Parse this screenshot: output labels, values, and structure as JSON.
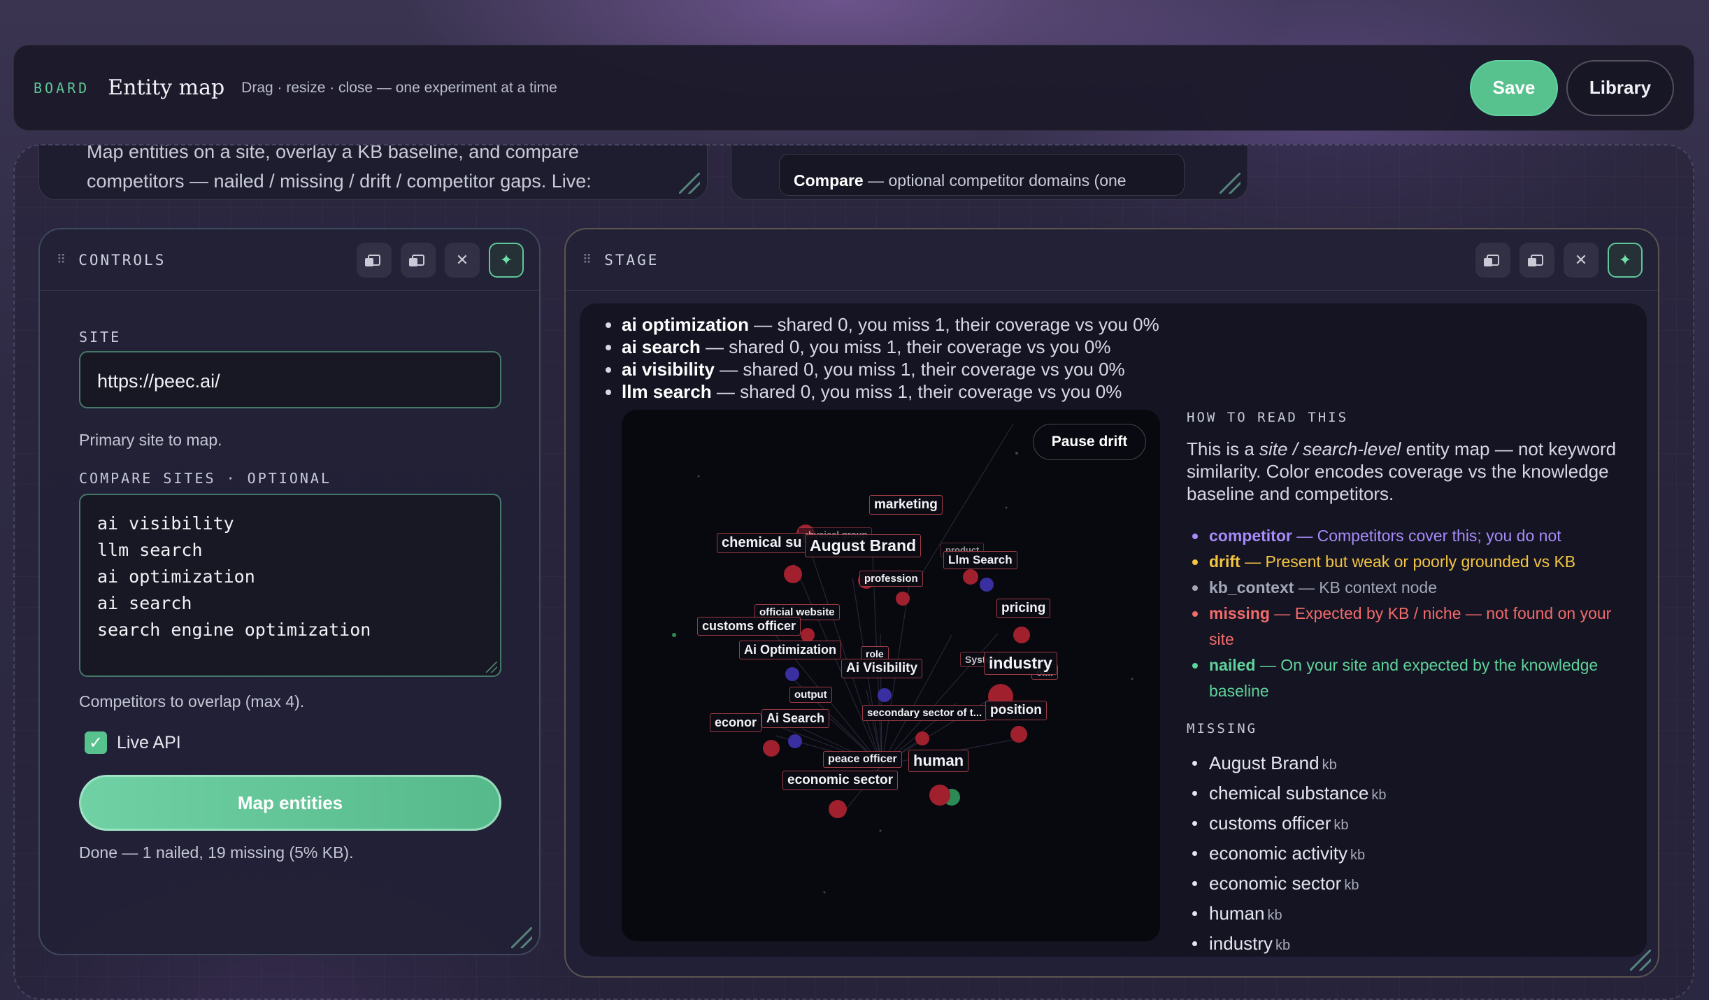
{
  "board": {
    "tag": "BOARD",
    "title": "Entity map",
    "subtitle": "Drag · resize · close — one experiment at a time",
    "save_label": "Save",
    "library_label": "Library"
  },
  "top_cards": {
    "intro_line1": "Map entities on a site, overlay a KB baseline, and compare",
    "intro_line2": "competitors — nailed / missing / drift / competitor gaps. Live:",
    "compare_bold": "Compare",
    "compare_rest": " — optional competitor domains (one"
  },
  "controls": {
    "title": "CONTROLS",
    "site_label": "SITE",
    "site_value": "https://peec.ai/",
    "site_help": "Primary site to map.",
    "compare_label": "COMPARE SITES · OPTIONAL",
    "compare_lines": [
      "ai visibility",
      "llm search",
      "ai optimization",
      "ai search",
      "search engine optimization"
    ],
    "compare_help": "Competitors to overlap (max 4).",
    "live_api_label": "Live API",
    "live_api_checked": true,
    "map_button": "Map entities",
    "status": "Done — 1 nailed, 19 missing (5% KB)."
  },
  "stage": {
    "title": "STAGE",
    "gaps": [
      {
        "term": "ai optimization",
        "text": " — shared 0, you miss 1, their coverage vs you 0%"
      },
      {
        "term": "ai search",
        "text": " — shared 0, you miss 1, their coverage vs you 0%"
      },
      {
        "term": "ai visibility",
        "text": " — shared 0, you miss 1, their coverage vs you 0%"
      },
      {
        "term": "llm search",
        "text": " — shared 0, you miss 1, their coverage vs you 0%"
      }
    ],
    "pause_label": "Pause drift",
    "graph_labels": {
      "marketing": "marketing",
      "chemical": "chemical su",
      "august_brand": "August Brand",
      "llm_search": "Llm Search",
      "profession": "profession",
      "official_website": "official website",
      "pricing": "pricing",
      "customs_officer": "customs officer",
      "ai_optimization": "Ai Optimization",
      "role": "role",
      "industry": "industry",
      "ai_visibility": "Ai Visibility",
      "system": "Syster",
      "techno": "ol...",
      "output": "output",
      "secondary_sector": "secondary sector of t...",
      "position": "position",
      "economic": "econor",
      "ai_search": "Ai Search",
      "peace_officer": "peace officer",
      "human": "human",
      "economic_sector": "economic sector",
      "physical_group": "physical group",
      "product": "product"
    },
    "how_to_title": "HOW TO READ THIS",
    "how_to_pre": "This is a ",
    "how_to_em": "site / search-level",
    "how_to_post": " entity map — not keyword similarity. Color encodes coverage vs the knowledge baseline and competitors.",
    "legend": [
      {
        "key": "competitor",
        "desc": " — Competitors cover this; you do not",
        "color": "#a78bfa"
      },
      {
        "key": "drift",
        "desc": " — Present but weak or poorly grounded vs KB",
        "color": "#f5c542"
      },
      {
        "key": "kb_context",
        "desc": " — KB context node",
        "color": "#a3a7b8"
      },
      {
        "key": "missing",
        "desc": " — Expected by KB / niche — not found on your site",
        "color": "#f26b6b"
      },
      {
        "key": "nailed",
        "desc": " — On your site and expected by the knowledge baseline",
        "color": "#5fd39b"
      }
    ],
    "missing_title": "MISSING",
    "missing": [
      {
        "name": "August Brand",
        "tag": "kb"
      },
      {
        "name": "chemical substance",
        "tag": "kb"
      },
      {
        "name": "customs officer",
        "tag": "kb"
      },
      {
        "name": "economic activity",
        "tag": "kb"
      },
      {
        "name": "economic sector",
        "tag": "kb"
      },
      {
        "name": "human",
        "tag": "kb"
      },
      {
        "name": "industry",
        "tag": "kb"
      }
    ]
  }
}
